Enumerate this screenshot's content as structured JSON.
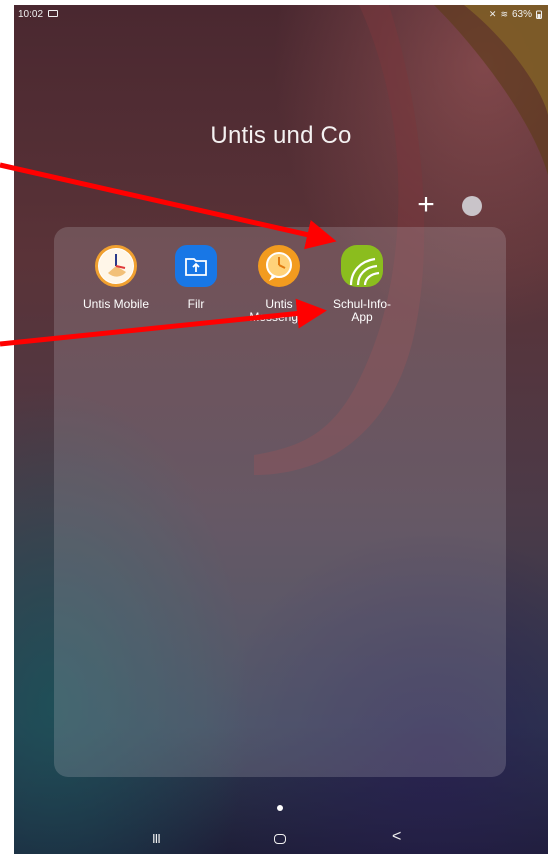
{
  "status_bar": {
    "time": "10:02",
    "battery": "63%",
    "icons": [
      "image-icon",
      "mute-icon",
      "wifi-icon",
      "battery-icon"
    ]
  },
  "folder": {
    "title": "Untis und Co",
    "add_symbol": "+",
    "color_accent": "#c9c4c9",
    "apps": [
      {
        "label": "Untis Mobile",
        "icon": "untis-mobile-clock-icon"
      },
      {
        "label": "Filr",
        "icon": "filr-folder-icon"
      },
      {
        "label": "Untis Messenger",
        "label_line1": "Untis",
        "label_line2": "Messenger",
        "icon": "untis-messenger-clock-icon"
      },
      {
        "label": "Schul-Info-App",
        "label_line1": "Schul-Info-",
        "label_line2": "App",
        "icon": "schul-info-app-icon"
      }
    ]
  },
  "navigation": {
    "recent_symbol": "III",
    "back_symbol": "<"
  },
  "annotation_colors": {
    "arrow": "#ff0000"
  }
}
